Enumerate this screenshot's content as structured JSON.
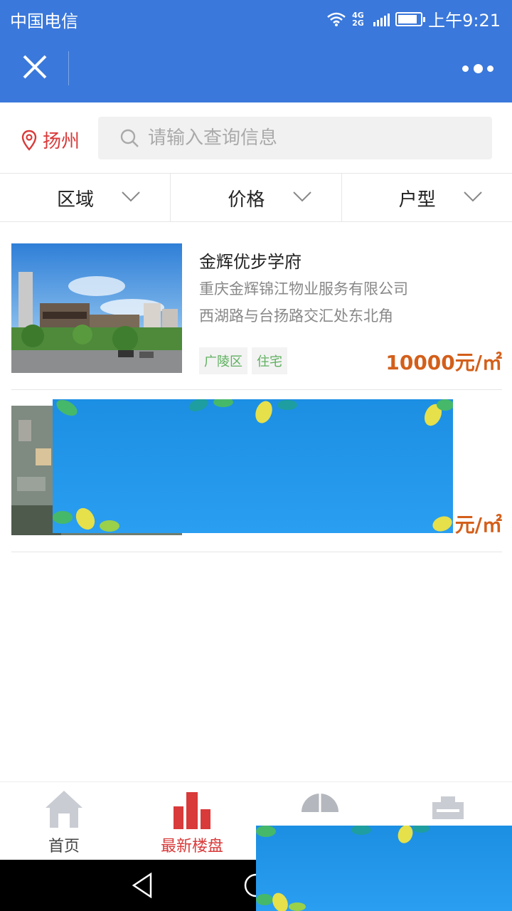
{
  "statusbar": {
    "carrier": "中国电信",
    "network": "4G\n2G",
    "time": "上午9:21"
  },
  "navbar": {
    "close_icon": "close-icon",
    "more_icon": "more-icon"
  },
  "search": {
    "city": "扬州",
    "placeholder": "请输入查询信息"
  },
  "filters": [
    {
      "label": "区域"
    },
    {
      "label": "价格"
    },
    {
      "label": "户型"
    }
  ],
  "listings": [
    {
      "name": "金辉优步学府",
      "company": "重庆金辉锦江物业服务有限公司",
      "address": "西湖路与台扬路交汇处东北角",
      "tags": [
        "广陵区",
        "住宅"
      ],
      "price": "10000元/㎡"
    },
    {
      "price_visible": "元/㎡"
    }
  ],
  "tabs": [
    {
      "label": "首页",
      "icon": "home-icon",
      "active": false
    },
    {
      "label": "最新楼盘",
      "icon": "buildings-icon",
      "active": true
    },
    {
      "label": "",
      "icon": "half-dome-icon",
      "active": false
    },
    {
      "label": "",
      "icon": "briefcase-icon",
      "active": false
    }
  ],
  "colors": {
    "primary": "#3a78db",
    "accent_red": "#d93a3a",
    "price": "#d35f1a",
    "tag_green": "#5fb05f"
  }
}
